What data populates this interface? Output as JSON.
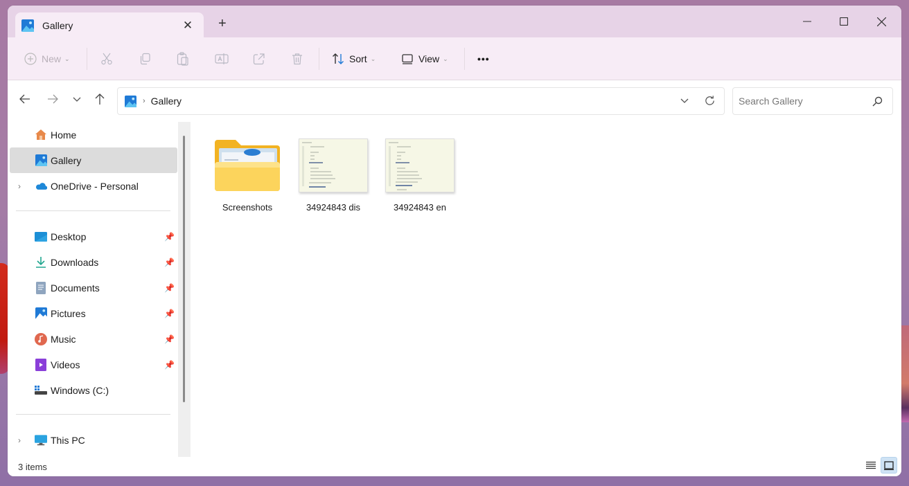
{
  "window": {
    "tab_title": "Gallery",
    "tab_icon": "gallery-icon",
    "new_tab_label": "+",
    "controls": {
      "minimize": "minimize-icon",
      "maximize": "maximize-icon",
      "close": "close-icon"
    }
  },
  "toolbar": {
    "new_label": "New",
    "cut": "cut-icon",
    "copy": "copy-icon",
    "paste": "paste-icon",
    "rename": "rename-icon",
    "share": "share-icon",
    "delete": "delete-icon",
    "sort_label": "Sort",
    "view_label": "View",
    "more_label": "•••"
  },
  "address": {
    "breadcrumb": [
      "Gallery"
    ],
    "search_placeholder": "Search Gallery",
    "search_value": ""
  },
  "sidebar": {
    "top": [
      {
        "label": "Home",
        "icon": "home-icon",
        "expandable": false,
        "selected": false
      },
      {
        "label": "Gallery",
        "icon": "gallery-icon",
        "expandable": false,
        "selected": true
      },
      {
        "label": "OneDrive - Personal",
        "icon": "onedrive-icon",
        "expandable": true,
        "selected": false
      }
    ],
    "quick_access": [
      {
        "label": "Desktop",
        "icon": "desktop-icon",
        "pinned": true
      },
      {
        "label": "Downloads",
        "icon": "downloads-icon",
        "pinned": true
      },
      {
        "label": "Documents",
        "icon": "documents-icon",
        "pinned": true
      },
      {
        "label": "Pictures",
        "icon": "pictures-icon",
        "pinned": true
      },
      {
        "label": "Music",
        "icon": "music-icon",
        "pinned": true
      },
      {
        "label": "Videos",
        "icon": "videos-icon",
        "pinned": true
      },
      {
        "label": "Windows (C:)",
        "icon": "drive-icon",
        "pinned": false
      }
    ],
    "bottom": [
      {
        "label": "This PC",
        "icon": "this-pc-icon",
        "expandable": true
      }
    ]
  },
  "content": {
    "items": [
      {
        "name": "Screenshots",
        "type": "folder"
      },
      {
        "name": "34924843 dis",
        "type": "image"
      },
      {
        "name": "34924843 en",
        "type": "image"
      }
    ]
  },
  "status": {
    "item_count": "3 items",
    "view_modes": [
      {
        "name": "details-view",
        "active": false
      },
      {
        "name": "large-icons-view",
        "active": true
      }
    ]
  },
  "colors": {
    "accent": "#0067c0",
    "selection": "#dcdcdc",
    "titlebar": "#e7d3e7",
    "toolbar": "#f7ecf6"
  }
}
